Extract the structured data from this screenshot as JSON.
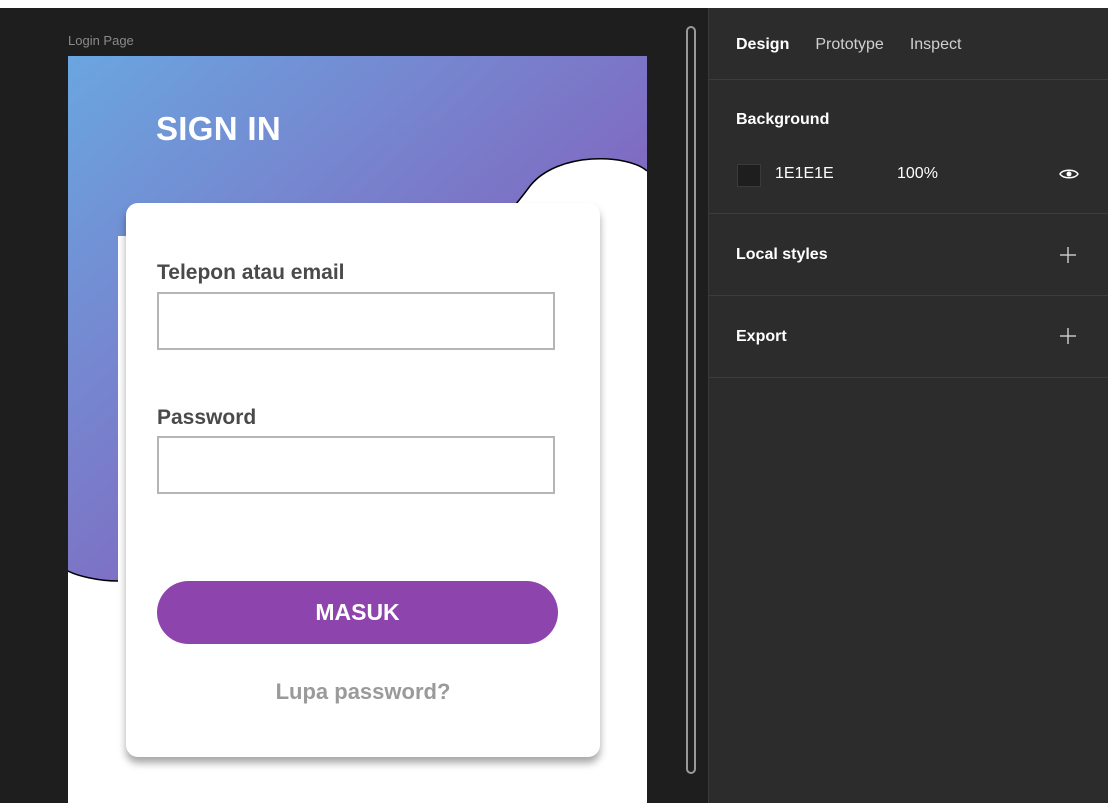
{
  "canvas": {
    "frame_label": "Login Page",
    "login": {
      "heading": "SIGN IN",
      "email_label": "Telepon atau email",
      "email_value": "",
      "password_label": "Password",
      "password_value": "",
      "submit_label": "MASUK",
      "forgot_label": "Lupa password?"
    },
    "colors": {
      "gradient_start": "#6aa6e0",
      "gradient_end": "#8e44ad",
      "button": "#8e44ad"
    }
  },
  "panel": {
    "tabs": [
      {
        "label": "Design",
        "active": true
      },
      {
        "label": "Prototype",
        "active": false
      },
      {
        "label": "Inspect",
        "active": false
      }
    ],
    "background": {
      "title": "Background",
      "hex": "1E1E1E",
      "opacity": "100%",
      "swatch_color": "#1E1E1E"
    },
    "local_styles": {
      "title": "Local styles"
    },
    "export": {
      "title": "Export"
    },
    "icons": [
      "eye-icon",
      "plus-icon",
      "plus-icon"
    ]
  }
}
